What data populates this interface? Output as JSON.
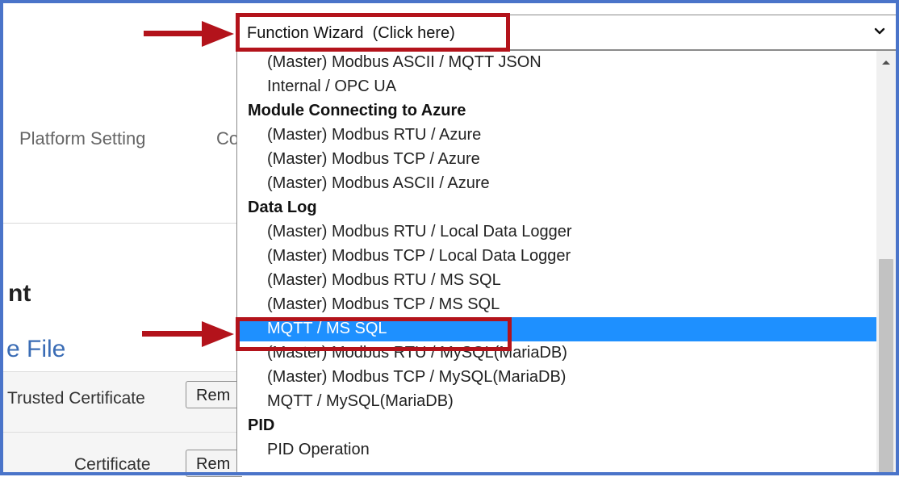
{
  "background": {
    "nav_platform": "Platform Setting",
    "nav_partial": "Co",
    "heading_partial": "nt",
    "subheading_partial": "e File",
    "rows": [
      {
        "label": "Trusted Certificate",
        "button": "Rem"
      },
      {
        "label": "Certificate",
        "button": "Rem"
      }
    ]
  },
  "select": {
    "value": "Function Wizard  (Click here)",
    "chevron_icon": "chevron-down-icon"
  },
  "dropdown": {
    "items": [
      {
        "label": "(Master) Modbus ASCII / MQTT JSON",
        "group": false
      },
      {
        "label": "Internal / OPC UA",
        "group": false
      },
      {
        "label": "Module Connecting to Azure",
        "group": true
      },
      {
        "label": "(Master) Modbus RTU / Azure",
        "group": false
      },
      {
        "label": "(Master) Modbus TCP / Azure",
        "group": false
      },
      {
        "label": "(Master) Modbus ASCII / Azure",
        "group": false
      },
      {
        "label": "Data Log",
        "group": true
      },
      {
        "label": "(Master) Modbus RTU / Local Data Logger",
        "group": false
      },
      {
        "label": "(Master) Modbus TCP / Local Data Logger",
        "group": false
      },
      {
        "label": "(Master) Modbus RTU / MS SQL",
        "group": false
      },
      {
        "label": "(Master) Modbus TCP / MS SQL",
        "group": false
      },
      {
        "label": "MQTT / MS SQL",
        "group": false,
        "selected": true
      },
      {
        "label": "(Master) Modbus RTU / MySQL(MariaDB)",
        "group": false
      },
      {
        "label": "(Master) Modbus TCP / MySQL(MariaDB)",
        "group": false
      },
      {
        "label": "MQTT / MySQL(MariaDB)",
        "group": false
      },
      {
        "label": "PID",
        "group": true
      },
      {
        "label": "PID Operation",
        "group": false
      }
    ],
    "selected_color": "#1e90ff"
  },
  "annotation": {
    "color": "#b3131b",
    "arrow_icon": "arrow-right-icon"
  }
}
